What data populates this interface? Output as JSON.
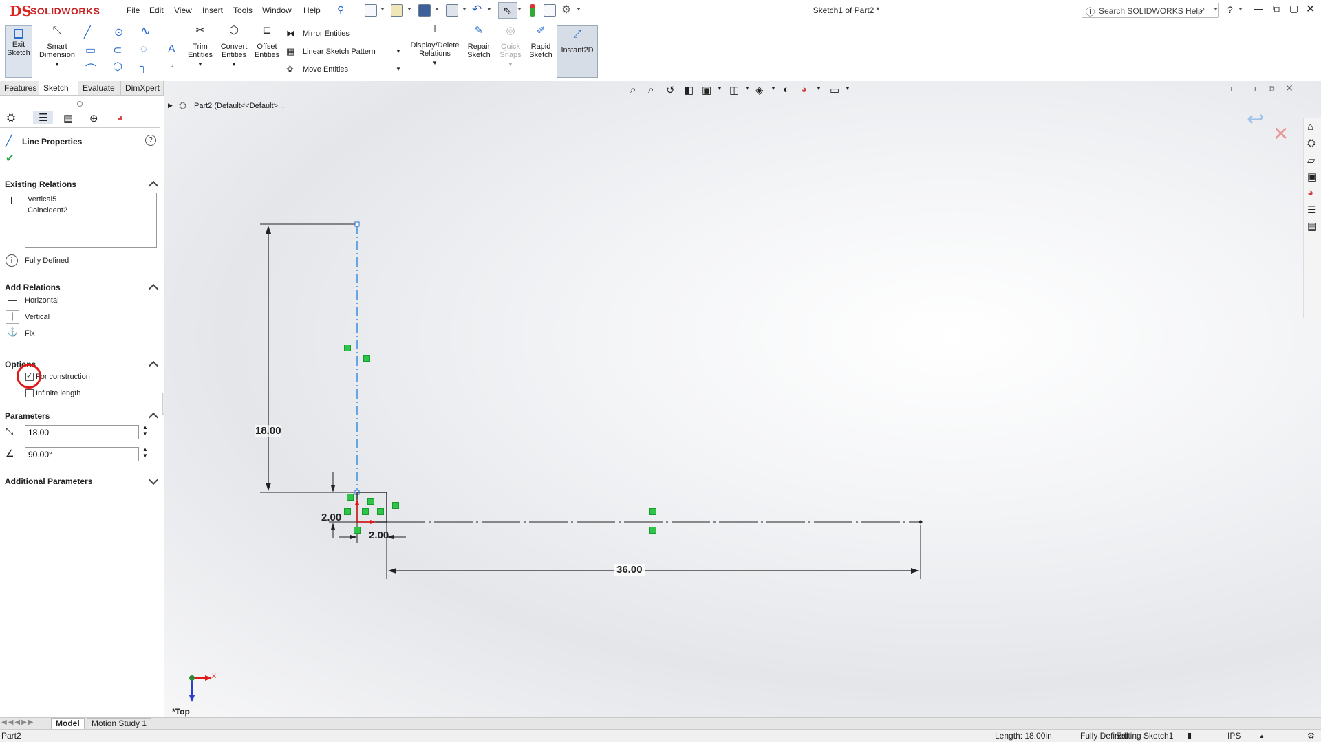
{
  "app": {
    "brand_prefix": "DS",
    "brand": "SOLIDWORKS",
    "document_title": "Sketch1 of Part2 *",
    "search_placeholder": "Search SOLIDWORKS Help",
    "menu": [
      "File",
      "Edit",
      "View",
      "Insert",
      "Tools",
      "Window",
      "Help"
    ]
  },
  "commands": {
    "exit_sketch": [
      "Exit",
      "Sketch"
    ],
    "smart_dimension": [
      "Smart",
      "Dimension"
    ],
    "trim_entities": [
      "Trim",
      "Entities"
    ],
    "convert_entities": [
      "Convert",
      "Entities"
    ],
    "offset_entities": [
      "Offset",
      "Entities"
    ],
    "mirror_entities": "Mirror Entities",
    "linear_sketch_pattern": "Linear Sketch Pattern",
    "move_entities": "Move Entities",
    "display_delete_relations": [
      "Display/Delete",
      "Relations"
    ],
    "repair_sketch": [
      "Repair",
      "Sketch"
    ],
    "quick_snaps": [
      "Quick",
      "Snaps"
    ],
    "rapid_sketch": [
      "Rapid",
      "Sketch"
    ],
    "instant2d": "Instant2D"
  },
  "tabs": [
    "Features",
    "Sketch",
    "Evaluate",
    "DimXpert"
  ],
  "property_manager": {
    "title": "Line Properties",
    "existing_relations": {
      "header": "Existing Relations",
      "items": [
        "Vertical5",
        "Coincident2"
      ],
      "status": "Fully Defined"
    },
    "add_relations": {
      "header": "Add Relations",
      "items": [
        "Horizontal",
        "Vertical",
        "Fix"
      ]
    },
    "options": {
      "header": "Options",
      "for_construction": "For construction",
      "for_construction_checked": true,
      "infinite_length": "Infinite length",
      "infinite_length_checked": false
    },
    "parameters": {
      "header": "Parameters",
      "length": "18.00",
      "angle": "90.00°"
    },
    "additional_parameters": "Additional Parameters"
  },
  "feature_tree": {
    "item": "Part2  (Default<<Default>..."
  },
  "sketch": {
    "dim_vertical": "18.00",
    "dim_small_v": "2.00",
    "dim_small_h": "2.00",
    "dim_horizontal": "36.00",
    "view_label": "*Top",
    "axis_x": "X"
  },
  "bottom_tabs": [
    "Model",
    "Motion Study 1"
  ],
  "status": {
    "doc": "Part2",
    "length": "Length: 18.00in",
    "defined": "Fully Defined",
    "editing": "Editing Sketch1",
    "units": "IPS"
  },
  "colors": {
    "accent": "#1f77d8",
    "relation_green": "#2fc44a",
    "annotation_red": "#e01818",
    "construction_blue": "#3a8fe0"
  }
}
